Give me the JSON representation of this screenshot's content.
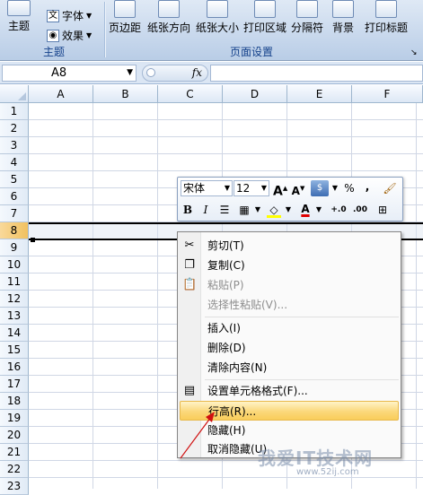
{
  "ribbon": {
    "theme": {
      "main_label": "主题",
      "font_label": "字体",
      "effect_label": "效果",
      "group_label": "主题"
    },
    "page_setup": {
      "buttons": [
        "页边距",
        "纸张方向",
        "纸张大小",
        "打印区域",
        "分隔符",
        "背景",
        "打印标题"
      ],
      "group_label": "页面设置"
    }
  },
  "formula_bar": {
    "name_box": "A8",
    "fx": "fx"
  },
  "columns": [
    "A",
    "B",
    "C",
    "D",
    "E",
    "F"
  ],
  "rows": [
    "1",
    "2",
    "3",
    "4",
    "5",
    "6",
    "7",
    "8",
    "9",
    "10",
    "11",
    "12",
    "13",
    "14",
    "15",
    "16",
    "17",
    "18",
    "19",
    "20",
    "21",
    "22",
    "23"
  ],
  "selected_row": "8",
  "mini_toolbar": {
    "font": "宋体",
    "size": "12",
    "grow_font": "A",
    "shrink_font": "A",
    "percent": "%",
    "comma": ",",
    "bold": "B",
    "italic": "I",
    "font_color": "A",
    "inc_decimal": "+.0",
    "dec_decimal": ".00"
  },
  "context_menu": {
    "items": [
      {
        "label": "剪切(T)",
        "disabled": false
      },
      {
        "label": "复制(C)",
        "disabled": false
      },
      {
        "label": "粘贴(P)",
        "disabled": true
      },
      {
        "label": "选择性粘贴(V)...",
        "disabled": true
      },
      {
        "label": "插入(I)",
        "disabled": false
      },
      {
        "label": "删除(D)",
        "disabled": false
      },
      {
        "label": "清除内容(N)",
        "disabled": false
      },
      {
        "label": "设置单元格格式(F)...",
        "disabled": false
      },
      {
        "label": "行高(R)...",
        "disabled": false,
        "highlighted": true
      },
      {
        "label": "隐藏(H)",
        "disabled": false
      },
      {
        "label": "取消隐藏(U)",
        "disabled": false
      }
    ]
  },
  "watermark": {
    "main": "我爱IT技术网",
    "url": "www.52ij.com"
  },
  "colors": {
    "highlight": "#f9cd5a",
    "ribbon": "#c4d5eb",
    "font_color_bar": "#e00000",
    "fill_color_bar": "#ffff00"
  }
}
